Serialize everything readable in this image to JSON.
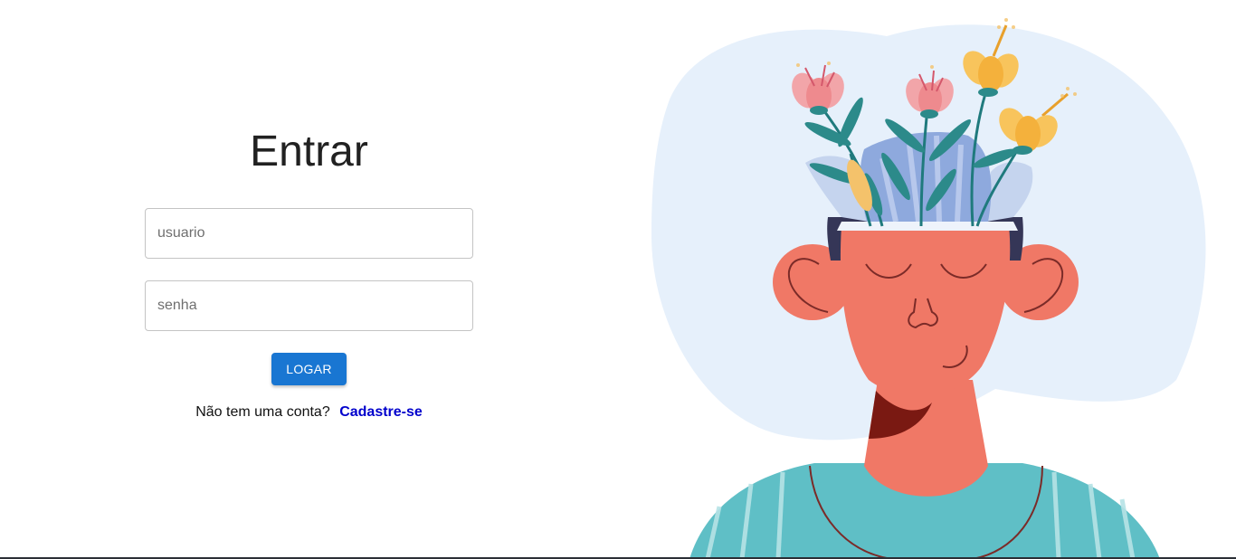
{
  "login": {
    "title": "Entrar",
    "username_placeholder": "usuario",
    "password_placeholder": "senha",
    "login_button": "LOGAR",
    "no_account_text": "Não tem uma conta?",
    "signup_link": "Cadastre-se"
  },
  "colors": {
    "primary": "#1976d2",
    "link": "#0000cc",
    "blob": "#e6f0fb",
    "skin": "#f07866",
    "shirt": "#5fbfc6",
    "hair": "#353657"
  },
  "illustration": {
    "subject": "person-with-flowers-growing-from-head"
  }
}
